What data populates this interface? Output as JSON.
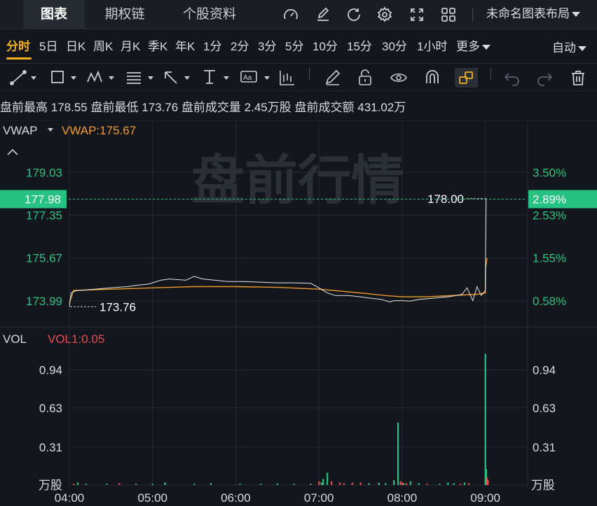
{
  "top_tabs": [
    {
      "label": "图表",
      "active": true
    },
    {
      "label": "期权链",
      "active": false
    },
    {
      "label": "个股资料",
      "active": false
    }
  ],
  "top_icons": [
    "gauge-icon",
    "edit-icon",
    "refresh-icon",
    "settings-icon",
    "fullscreen-icon",
    "grid-icon"
  ],
  "layout_label": "未命名图表布局",
  "periods": [
    "分时",
    "5日",
    "日K",
    "周K",
    "月K",
    "季K",
    "年K",
    "1分",
    "2分",
    "3分",
    "5分",
    "10分",
    "15分",
    "30分",
    "1小时",
    "更多"
  ],
  "active_period": "分时",
  "auto_label": "自动",
  "toolbar_icons": [
    "line-tool-icon",
    "rectangle-tool-icon",
    "pattern-tool-icon",
    "fib-tool-icon",
    "arrow-tool-icon",
    "text-marker-icon",
    "text-tool-icon",
    "bar-tool-icon",
    "pencil-icon",
    "unlock-icon",
    "eye-icon",
    "magnet-icon",
    "link-icon",
    "undo-icon",
    "redo-icon",
    "trash-icon"
  ],
  "premarket": {
    "high_label": "盘前最高",
    "high": "178.55",
    "low_label": "盘前最低",
    "low": "173.76",
    "volume_label": "盘前成交量",
    "volume": "2.45万股",
    "amount_label": "盘前成交额",
    "amount": "431.02万"
  },
  "watermark": "盘前行情",
  "colors": {
    "up": "#26c281",
    "down": "#e84b52",
    "vwap": "#f09a27",
    "price": "#e6e6e6",
    "accent": "#f2b01e"
  },
  "chart_data": [
    {
      "type": "line",
      "indicator_label": "VWAP",
      "indicator_value": "VWAP:175.67",
      "y_ticks_left": [
        "179.03",
        "177.35",
        "175.67",
        "173.99"
      ],
      "y_ticks_right": [
        "3.50%",
        "2.53%",
        "1.55%",
        "0.58%"
      ],
      "current_price_label": "177.98",
      "current_pct_label": "2.89%",
      "high_annotation": "178.00",
      "low_annotation": "173.76",
      "ylim": [
        173.0,
        180.3
      ],
      "x_ticks": [
        "04:00",
        "05:00",
        "06:00",
        "07:00",
        "08:00",
        "09:00"
      ],
      "x_range_hours": [
        4.0,
        9.5
      ],
      "series": [
        {
          "key": "price",
          "x": [
            4.0,
            4.02,
            4.05,
            4.1,
            4.2,
            4.3,
            4.5,
            4.7,
            4.8,
            4.95,
            5.1,
            5.2,
            5.4,
            5.5,
            5.6,
            5.75,
            5.9,
            6.1,
            6.3,
            6.5,
            6.7,
            6.9,
            7.0,
            7.1,
            7.2,
            7.35,
            7.5,
            7.6,
            7.75,
            7.85,
            7.9,
            8.0,
            8.1,
            8.2,
            8.4,
            8.55,
            8.65,
            8.72,
            8.78,
            8.85,
            8.9,
            8.95,
            9.0,
            9.005,
            9.01
          ],
          "y": [
            173.76,
            174.3,
            174.35,
            174.4,
            174.42,
            174.45,
            174.5,
            174.55,
            174.6,
            174.65,
            174.8,
            174.85,
            174.8,
            174.95,
            174.85,
            174.8,
            174.75,
            174.75,
            174.72,
            174.7,
            174.7,
            174.68,
            174.5,
            174.3,
            174.2,
            174.2,
            174.15,
            174.1,
            174.05,
            173.95,
            174.0,
            174.0,
            173.98,
            174.05,
            174.1,
            174.15,
            174.2,
            174.25,
            174.5,
            174.0,
            174.55,
            174.2,
            174.4,
            176.5,
            178.0
          ]
        },
        {
          "key": "vwap",
          "x": [
            4.0,
            4.05,
            4.5,
            5.0,
            5.5,
            6.0,
            6.5,
            7.0,
            7.5,
            7.8,
            8.0,
            8.3,
            8.6,
            8.9,
            9.0,
            9.005,
            9.02
          ],
          "y": [
            173.9,
            174.4,
            174.45,
            174.5,
            174.55,
            174.55,
            174.52,
            174.45,
            174.3,
            174.2,
            174.15,
            174.15,
            174.2,
            174.25,
            174.3,
            175.3,
            175.67
          ]
        }
      ]
    },
    {
      "type": "bar",
      "indicator_label": "VOL",
      "indicator_value": "VOL1:0.05",
      "y_ticks": [
        "0.94",
        "0.63",
        "0.31"
      ],
      "unit_label": "万股",
      "ylim": [
        0,
        1.2
      ],
      "x": [
        4.05,
        4.1,
        4.2,
        4.45,
        4.6,
        4.8,
        5.0,
        5.15,
        5.5,
        5.7,
        6.05,
        6.3,
        6.5,
        6.7,
        6.9,
        7.0,
        7.03,
        7.05,
        7.1,
        7.15,
        7.25,
        7.3,
        7.4,
        7.5,
        7.6,
        7.72,
        7.8,
        7.9,
        7.95,
        7.98,
        8.0,
        8.02,
        8.05,
        8.1,
        8.2,
        8.3,
        8.45,
        8.55,
        8.62,
        8.7,
        8.75,
        8.8,
        9.0,
        9.01,
        9.02,
        9.03
      ],
      "values": [
        0.01,
        0.02,
        0.01,
        0.01,
        0.015,
        0.01,
        0.01,
        0.02,
        0.01,
        0.015,
        0.01,
        0.01,
        0.012,
        0.01,
        0.01,
        0.03,
        0.02,
        0.05,
        0.1,
        0.03,
        0.02,
        0.015,
        0.02,
        0.02,
        0.015,
        0.02,
        0.015,
        0.04,
        0.51,
        0.03,
        0.02,
        0.015,
        0.015,
        0.03,
        0.015,
        0.01,
        0.01,
        0.02,
        0.015,
        0.01,
        0.02,
        0.015,
        1.07,
        0.13,
        0.06,
        0.04
      ],
      "colors": [
        "down",
        "up",
        "up",
        "up",
        "down",
        "up",
        "up",
        "up",
        "up",
        "up",
        "up",
        "up",
        "up",
        "up",
        "up",
        "down",
        "up",
        "up",
        "up",
        "down",
        "down",
        "down",
        "down",
        "down",
        "up",
        "up",
        "up",
        "up",
        "up",
        "down",
        "down",
        "up",
        "down",
        "up",
        "up",
        "down",
        "up",
        "up",
        "up",
        "down",
        "up",
        "down",
        "up",
        "up",
        "down",
        "down"
      ]
    }
  ]
}
